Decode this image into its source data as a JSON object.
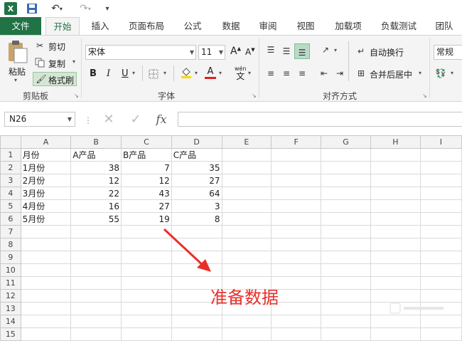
{
  "quick_access": {
    "logo": "X",
    "icons": [
      "excel-logo-icon",
      "save-icon",
      "undo-icon",
      "redo-icon",
      "customize-qat-icon"
    ]
  },
  "tabs": [
    {
      "label": "文件"
    },
    {
      "label": "开始"
    },
    {
      "label": "插入"
    },
    {
      "label": "页面布局"
    },
    {
      "label": "公式"
    },
    {
      "label": "数据"
    },
    {
      "label": "审阅"
    },
    {
      "label": "视图"
    },
    {
      "label": "加载项"
    },
    {
      "label": "负载测试"
    },
    {
      "label": "团队"
    }
  ],
  "ribbon": {
    "clipboard": {
      "paste_label": "粘贴",
      "cut_label": "剪切",
      "copy_label": "复制",
      "format_painter_label": "格式刷",
      "group_label": "剪贴板"
    },
    "font": {
      "font_name": "宋体",
      "font_size": "11",
      "grow_label": "A",
      "shrink_label": "A",
      "bold": "B",
      "italic": "I",
      "underline": "U",
      "pinyin_label": "wén",
      "group_label": "字体"
    },
    "alignment": {
      "wrap_text_label": "自动换行",
      "merge_center_label": "合并后居中",
      "group_label": "对齐方式"
    },
    "number": {
      "format_value": "常规"
    }
  },
  "formula_bar": {
    "name_box": "N26",
    "fx_label": "fx",
    "formula": ""
  },
  "sheet": {
    "columns": [
      "A",
      "B",
      "C",
      "D",
      "E",
      "F",
      "G",
      "H",
      "I"
    ],
    "rows": [
      [
        "月份",
        "A产品",
        "B产品",
        "C产品",
        "",
        "",
        "",
        "",
        ""
      ],
      [
        "1月份",
        "38",
        "7",
        "35",
        "",
        "",
        "",
        "",
        ""
      ],
      [
        "2月份",
        "12",
        "12",
        "27",
        "",
        "",
        "",
        "",
        ""
      ],
      [
        "3月份",
        "22",
        "43",
        "64",
        "",
        "",
        "",
        "",
        ""
      ],
      [
        "4月份",
        "16",
        "27",
        "3",
        "",
        "",
        "",
        "",
        ""
      ],
      [
        "5月份",
        "55",
        "19",
        "8",
        "",
        "",
        "",
        "",
        ""
      ],
      [
        "",
        "",
        "",
        "",
        "",
        "",
        "",
        "",
        ""
      ],
      [
        "",
        "",
        "",
        "",
        "",
        "",
        "",
        "",
        ""
      ],
      [
        "",
        "",
        "",
        "",
        "",
        "",
        "",
        "",
        ""
      ],
      [
        "",
        "",
        "",
        "",
        "",
        "",
        "",
        "",
        ""
      ],
      [
        "",
        "",
        "",
        "",
        "",
        "",
        "",
        "",
        ""
      ],
      [
        "",
        "",
        "",
        "",
        "",
        "",
        "",
        "",
        ""
      ],
      [
        "",
        "",
        "",
        "",
        "",
        "",
        "",
        "",
        ""
      ],
      [
        "",
        "",
        "",
        "",
        "",
        "",
        "",
        "",
        ""
      ],
      [
        "",
        "",
        "",
        "",
        "",
        "",
        "",
        "",
        ""
      ]
    ],
    "row_numbers": [
      "1",
      "2",
      "3",
      "4",
      "5",
      "6",
      "7",
      "8",
      "9",
      "10",
      "11",
      "12",
      "13",
      "14",
      "15"
    ]
  },
  "annotation": {
    "text": "准备数据",
    "color": "#e8302a"
  },
  "colors": {
    "excel_green": "#217346",
    "ribbon_bg": "#f4f4f4"
  }
}
